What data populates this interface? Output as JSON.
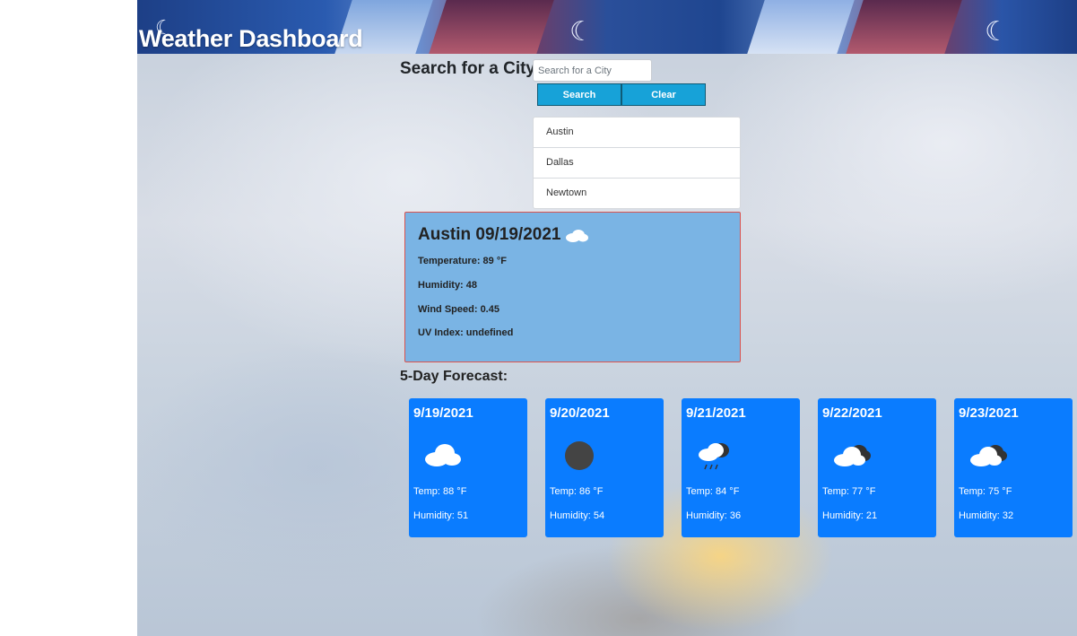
{
  "header": {
    "title": "Weather Dashboard"
  },
  "search": {
    "label": "Search for a City",
    "placeholder": "Search for a City",
    "value": "",
    "search_label": "Search",
    "clear_label": "Clear"
  },
  "history": [
    "Austin",
    "Dallas",
    "Newtown"
  ],
  "current": {
    "city_date": "Austin 09/19/2021",
    "icon": "cloud-icon",
    "temperature": "Temperature: 89 °F",
    "humidity": "Humidity: 48",
    "wind": "Wind Speed: 0.45",
    "uv": "UV Index: undefined"
  },
  "forecast": {
    "label": "5-Day Forecast:",
    "days": [
      {
        "date": "9/19/2021",
        "icon": "cloud-icon",
        "temp": "Temp: 88 °F",
        "humidity": "Humidity: 51"
      },
      {
        "date": "9/20/2021",
        "icon": "dark-circle-icon",
        "temp": "Temp: 86 °F",
        "humidity": "Humidity: 54"
      },
      {
        "date": "9/21/2021",
        "icon": "rain-cloud-icon",
        "temp": "Temp: 84 °F",
        "humidity": "Humidity: 36"
      },
      {
        "date": "9/22/2021",
        "icon": "broken-clouds-icon",
        "temp": "Temp: 77 °F",
        "humidity": "Humidity: 21"
      },
      {
        "date": "9/23/2021",
        "icon": "broken-clouds-icon",
        "temp": "Temp: 75 °F",
        "humidity": "Humidity: 32"
      }
    ]
  },
  "colors": {
    "card_blue": "#0a7cff",
    "current_bg": "#7ab4e4",
    "button": "#17a2d8"
  }
}
